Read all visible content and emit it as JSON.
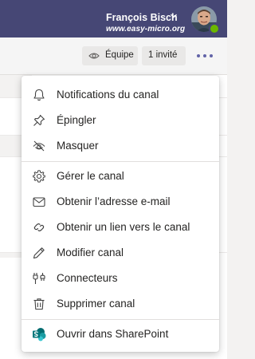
{
  "user": {
    "name": "François Bisch",
    "watermark": "www.easy-micro.org",
    "presence": "available"
  },
  "header": {
    "team_label": "Équipe",
    "guest_label": "1 invité"
  },
  "menu": {
    "items": [
      {
        "label": "Notifications du canal",
        "icon": "bell-icon"
      },
      {
        "label": "Épingler",
        "icon": "pin-icon"
      },
      {
        "label": "Masquer",
        "icon": "eye-off-icon"
      },
      {
        "label": "Gérer le canal",
        "icon": "gear-icon"
      },
      {
        "label": "Obtenir l’adresse e-mail",
        "icon": "mail-icon"
      },
      {
        "label": "Obtenir un lien vers le canal",
        "icon": "link-icon"
      },
      {
        "label": "Modifier canal",
        "icon": "pencil-icon"
      },
      {
        "label": "Connecteurs",
        "icon": "connectors-icon"
      },
      {
        "label": "Supprimer canal",
        "icon": "trash-icon"
      },
      {
        "label": "Ouvrir dans SharePoint",
        "icon": "sharepoint-icon"
      }
    ]
  },
  "colors": {
    "topbar": "#464775",
    "accent": "#6264a7",
    "presence": "#6bb700",
    "sharepoint": "#036c70"
  }
}
